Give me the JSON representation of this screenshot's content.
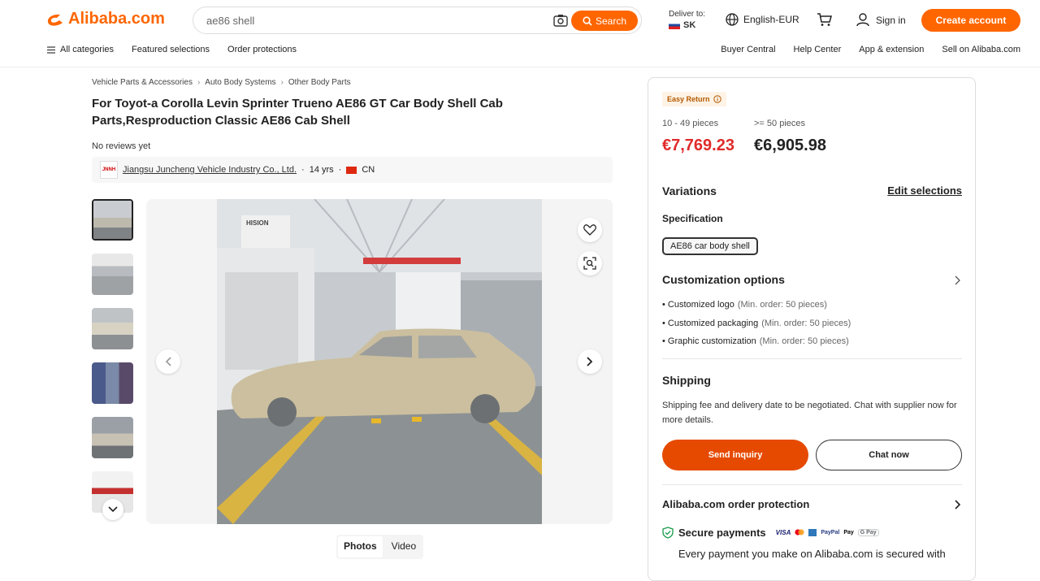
{
  "header": {
    "logo_text": "Alibaba.com",
    "search_value": "ae86 shell",
    "search_button": "Search",
    "deliver_label": "Deliver to:",
    "deliver_country": "SK",
    "language": "English-EUR",
    "signin": "Sign in",
    "create_account": "Create account"
  },
  "nav": {
    "all_categories": "All categories",
    "left_items": [
      "Featured selections",
      "Order protections"
    ],
    "right_items": [
      "Buyer Central",
      "Help Center",
      "App & extension",
      "Sell on Alibaba.com"
    ]
  },
  "breadcrumb": [
    "Vehicle Parts & Accessories",
    "Auto Body Systems",
    "Other Body Parts"
  ],
  "product": {
    "title": "For Toyot-a Corolla Levin Sprinter Trueno AE86 GT Car Body Shell Cab Parts,Resproduction Classic AE86 Cab Shell",
    "reviews": "No reviews yet",
    "supplier_name": "Jiangsu Juncheng Vehicle Industry Co., Ltd.",
    "supplier_years": "14 yrs",
    "supplier_country": "CN",
    "photo_brand": "HISION"
  },
  "media_tabs": [
    "Photos",
    "Video"
  ],
  "panel": {
    "easy_return": "Easy Return",
    "tiers": [
      {
        "range": "10 - 49 pieces",
        "price": "€7,769.23",
        "color": "#e02b2b"
      },
      {
        "range": ">= 50 pieces",
        "price": "€6,905.98",
        "color": "#222222"
      }
    ],
    "variations_title": "Variations",
    "edit_selections": "Edit selections",
    "specification_label": "Specification",
    "specification_value": "AE86 car body shell",
    "customization_title": "Customization options",
    "customization_items": [
      {
        "name": "Customized logo",
        "min": "(Min. order: 50 pieces)"
      },
      {
        "name": "Customized packaging",
        "min": "(Min. order: 50 pieces)"
      },
      {
        "name": "Graphic customization",
        "min": "(Min. order: 50 pieces)"
      }
    ],
    "shipping_title": "Shipping",
    "shipping_text": "Shipping fee and delivery date to be negotiated. Chat with supplier now for more details.",
    "send_inquiry": "Send inquiry",
    "chat_now": "Chat now",
    "order_protection": "Alibaba.com order protection",
    "secure_payments": "Secure payments",
    "payment_logos": [
      "VISA",
      "MC",
      "AMEX",
      "PayPal",
      "Pay",
      "G Pay"
    ],
    "secure_text": "Every payment you make on Alibaba.com is secured with"
  },
  "colors": {
    "brand": "#ff6600",
    "price_red": "#e02b2b",
    "send_btn": "#e64a00"
  }
}
